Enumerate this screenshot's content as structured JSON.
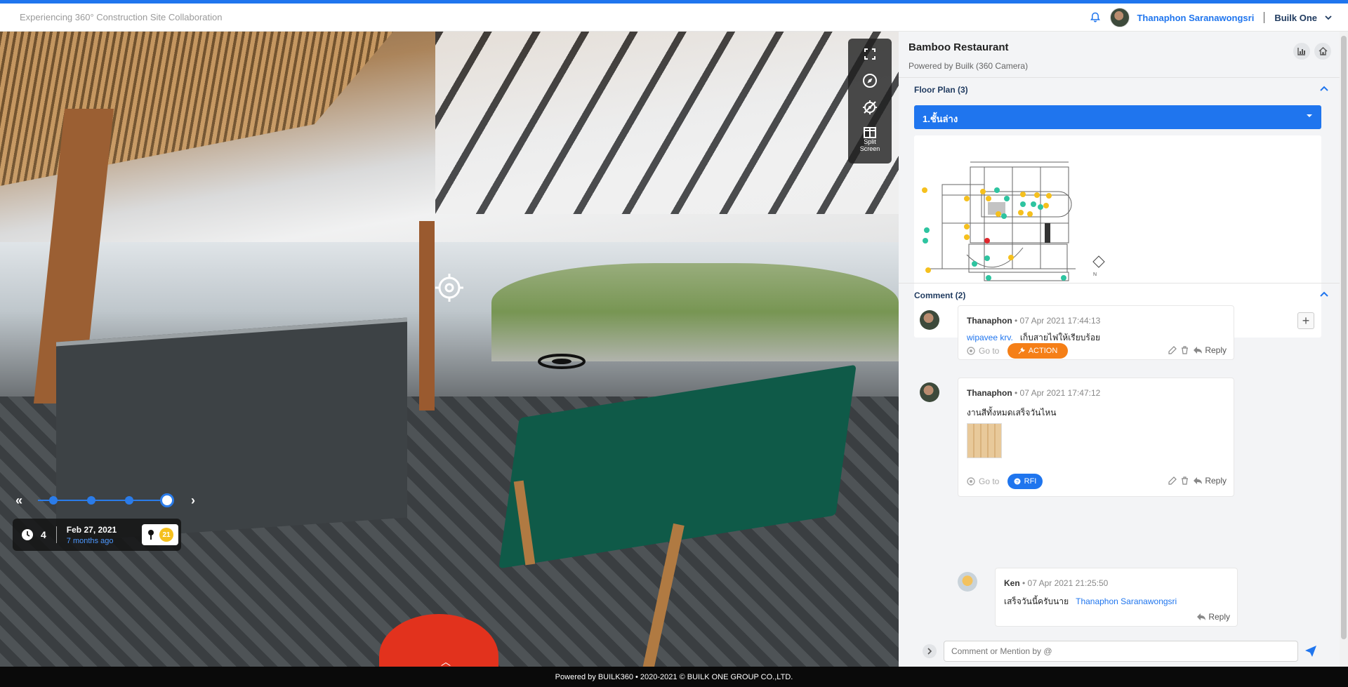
{
  "header": {
    "app_title": "Experiencing 360° Construction Site Collaboration",
    "username": "Thanaphon Saranawongsri",
    "org": "Builk One"
  },
  "viewer": {
    "tools": {
      "split_label_1": "Split",
      "split_label_2": "Screen"
    },
    "snapshot_count": "4",
    "date": "Feb 27, 2021",
    "relative_date": "7 months ago",
    "pin_count": "21"
  },
  "panel": {
    "title": "Bamboo Restaurant",
    "subtitle": "Powered by Builk (360 Camera)",
    "floor_plan": {
      "heading": "Floor Plan (3)",
      "selected": "1.ชั้นล่าง"
    },
    "comments": {
      "heading": "Comment (2)",
      "items": [
        {
          "author": "Thanaphon",
          "time": "• 07 Apr 2021 17:44:13",
          "mention": "wipavee krv.",
          "text": "เก็บสายไฟให้เรียบร้อย",
          "goto": "Go to",
          "tag": "ACTION",
          "reply": "Reply"
        },
        {
          "author": "Thanaphon",
          "time": "• 07 Apr 2021 17:47:12",
          "text": "งานสีทั้งหมดเสร็จวันไหน",
          "goto": "Go to",
          "tag": "RFI",
          "reply": "Reply"
        }
      ],
      "reply_item": {
        "author": "Ken",
        "time": "• 07 Apr 2021 21:25:50",
        "text": "เสร็จวันนี้ครับนาย",
        "mention": "Thanaphon Saranawongsri",
        "reply": "Reply"
      },
      "input_placeholder": "Comment or Mention by @"
    }
  },
  "footer": {
    "text": "Powered by BUILK360 • 2020-2021 © BUILK ONE GROUP CO.,LTD."
  },
  "colors": {
    "accent": "#1f75ee",
    "action": "#f57f17",
    "pin": "#f5c01e"
  }
}
